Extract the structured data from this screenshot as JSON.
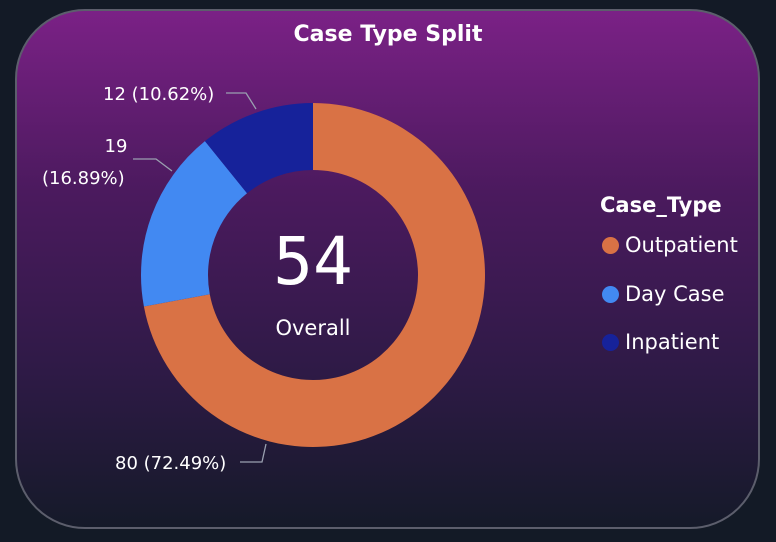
{
  "chart_data": {
    "type": "pie",
    "title": "Case Type Split",
    "center": {
      "value": "54",
      "label": "Overall"
    },
    "legend_title": "Case_Type",
    "legend_position": "right",
    "slices": [
      {
        "name": "Outpatient",
        "value": 80,
        "percent": "72.49%",
        "label": "80 (72.49%)",
        "color": "#d97245"
      },
      {
        "name": "Day Case",
        "value": 19,
        "percent": "16.89%",
        "label_line1": "19",
        "label_line2": "(16.89%)",
        "color": "#4289f2"
      },
      {
        "name": "Inpatient",
        "value": 12,
        "percent": "10.62%",
        "label": "12 (10.62%)",
        "color": "#16229a"
      }
    ]
  }
}
